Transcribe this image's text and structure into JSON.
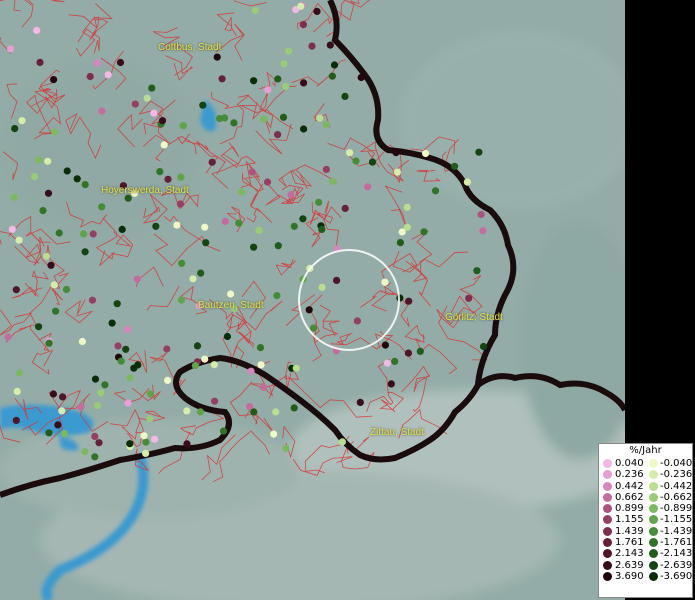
{
  "cities": [
    {
      "id": "cottbus",
      "name": "Cottbus, Stadt"
    },
    {
      "id": "hoyerswerda",
      "name": "Hoyerswerda, Stadt"
    },
    {
      "id": "bautzen",
      "name": "Bautzen, Stadt"
    },
    {
      "id": "goerlitz",
      "name": "Görlitz, Stadt"
    },
    {
      "id": "zittau",
      "name": "Zittau, Stadt"
    }
  ],
  "legend": {
    "title": "%/Jahr",
    "positive": [
      {
        "label": "0.040",
        "color": "#f4b8e6"
      },
      {
        "label": "0.236",
        "color": "#e8a0d4"
      },
      {
        "label": "0.442",
        "color": "#d886bd"
      },
      {
        "label": "0.662",
        "color": "#c56b9e"
      },
      {
        "label": "0.899",
        "color": "#ae527f"
      },
      {
        "label": "1.155",
        "color": "#973e65"
      },
      {
        "label": "1.439",
        "color": "#7f2d4d"
      },
      {
        "label": "1.761",
        "color": "#67203a"
      },
      {
        "label": "2.143",
        "color": "#4f1528"
      },
      {
        "label": "2.639",
        "color": "#380c1a"
      },
      {
        "label": "3.690",
        "color": "#22060e"
      }
    ],
    "negative": [
      {
        "label": "-0.040",
        "color": "#eef8c4"
      },
      {
        "label": "-0.236",
        "color": "#d6edaa"
      },
      {
        "label": "-0.442",
        "color": "#b8de8e"
      },
      {
        "label": "-0.662",
        "color": "#99cc74"
      },
      {
        "label": "-0.899",
        "color": "#7cb95e"
      },
      {
        "label": "-1.155",
        "color": "#5fa448"
      },
      {
        "label": "-1.439",
        "color": "#458c36"
      },
      {
        "label": "-1.761",
        "color": "#317427"
      },
      {
        "label": "-2.143",
        "color": "#215c1b"
      },
      {
        "label": "-2.639",
        "color": "#144411"
      },
      {
        "label": "-3.690",
        "color": "#092d08"
      }
    ]
  },
  "colors": {
    "land": "#93aca7",
    "land_dark": "#7e9a95",
    "mountain": "#b7c4c0",
    "border": "#1a0c0c",
    "districts": "#d43a3a",
    "water": "#3a9ad0",
    "selection_ring": "#ffffff",
    "label": "#e8e04a"
  }
}
